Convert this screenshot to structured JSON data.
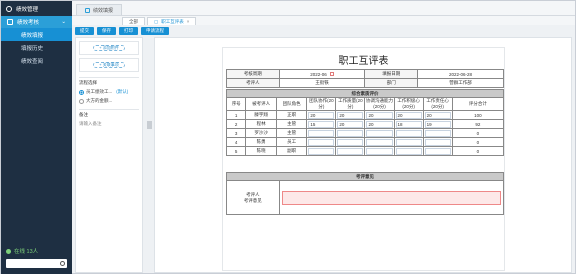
{
  "sidebar": {
    "title": "绩效管理",
    "group": "绩效考核",
    "items": [
      {
        "label": "绩效填报",
        "active": true
      },
      {
        "label": "填报历史",
        "active": false
      },
      {
        "label": "绩效查阅",
        "active": false
      }
    ],
    "online_label": "在线 13人"
  },
  "topbar": {
    "tab": "绩效填报"
  },
  "subtabs": [
    {
      "label": "全部"
    },
    {
      "label": "职工互评表",
      "close": "×"
    }
  ],
  "toolbar": [
    "提交",
    "保存",
    "打印",
    "申请流程"
  ],
  "left_panel": {
    "add_attachment": "+ 添加附件",
    "add_link": "+ 关联事项",
    "flow_title": "流程选择",
    "flow_options": [
      {
        "label": "员工绩效工...",
        "extra": "(默认)",
        "selected": true
      },
      {
        "label": "大方的金额...",
        "extra": "",
        "selected": false
      }
    ],
    "note_title": "备注",
    "note_placeholder": "请输入备注"
  },
  "form": {
    "title": "职工互评表",
    "period_label": "考核周期",
    "period_value": "2022-06",
    "fill_date_label": "填报日期",
    "fill_date_value": "2022-06-28",
    "evaluator_label": "考评人",
    "evaluator_value": "王街铁",
    "dept_label": "部门",
    "dept_value": "营群工作部",
    "section1": "综合素质评价",
    "headers": [
      "序号",
      "被考评人",
      "团队角色",
      "团队协作(20分)",
      "工作质量(20分)",
      "协调沟通能力(20分)",
      "工作积极心(20分)",
      "工作责任心(20分)",
      "评分合计"
    ],
    "rows": [
      {
        "no": "1",
        "name": "滕宇翔",
        "role": "正职",
        "scores": [
          "20",
          "20",
          "20",
          "20",
          "20"
        ],
        "total": "100"
      },
      {
        "no": "2",
        "name": "程林",
        "role": "主管",
        "scores": [
          "15",
          "20",
          "20",
          "18",
          "19"
        ],
        "total": "92"
      },
      {
        "no": "3",
        "name": "罗沙沙",
        "role": "主管",
        "scores": [
          "",
          "",
          "",
          "",
          ""
        ],
        "total": "0"
      },
      {
        "no": "4",
        "name": "陈勇",
        "role": "员工",
        "scores": [
          "",
          "",
          "",
          "",
          ""
        ],
        "total": "0"
      },
      {
        "no": "5",
        "name": "陈晓",
        "role": "副职",
        "scores": [
          "",
          "",
          "",
          "",
          ""
        ],
        "total": "0"
      }
    ],
    "section2": "考评意见",
    "opinion_label_1": "考评人",
    "opinion_label_2": "考评意见"
  }
}
